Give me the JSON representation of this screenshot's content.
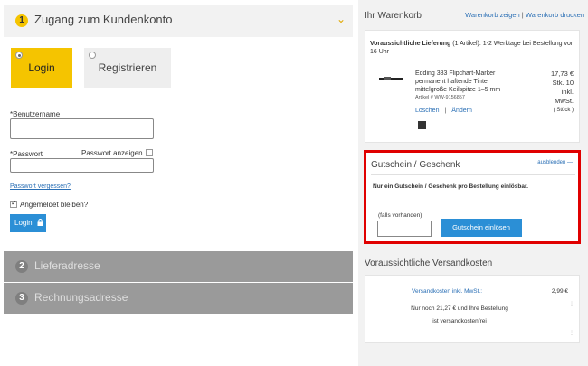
{
  "steps": {
    "step1": {
      "num": "1",
      "title": "Zugang zum Kundenkonto"
    },
    "step2": {
      "num": "2",
      "title": "Lieferadresse"
    },
    "step3": {
      "num": "3",
      "title": "Rechnungsadresse"
    }
  },
  "auth_tabs": {
    "login": "Login",
    "register": "Registrieren"
  },
  "login_form": {
    "username_label": "*Benutzername",
    "password_label": "*Passwort",
    "show_password_label": "Passwort anzeigen",
    "forgot_password": "Passwort vergessen?",
    "remember_label": "Angemeldet bleiben?",
    "login_button": "Login"
  },
  "cart": {
    "title": "Ihr Warenkorb",
    "show_link": "Warenkorb zeigen",
    "print_link": "Warenkorb drucken",
    "links_sep": "|",
    "delivery_bold": "Voraussichtliche Lieferung",
    "delivery_count": "(1 Artikel)",
    "delivery_text": ": 1-2 Werktage bei Bestellung vor 16 Uhr",
    "product": {
      "name_line1": "Edding 383 Flipchart-Marker",
      "name_line2": "permanent haftende Tinte",
      "name_line3": "mittelgroße Keilspitze 1–5 mm",
      "article": "Artikel # WW-9156857",
      "price": "17,73 €",
      "qty": "Stk. 10",
      "vat1": "inkl.",
      "vat2": "MwSt.",
      "unit": "( Stück )",
      "delete": "Löschen",
      "sep": "|",
      "change": "Ändern"
    }
  },
  "voucher": {
    "title": "Gutschein / Geschenk",
    "hide": "ausblenden —",
    "note": "Nur ein Gutschein / Geschenk pro Bestellung einlösbar.",
    "input_label": "(falls vorhanden)",
    "button": "Gutschein einlösen"
  },
  "shipping": {
    "title": "Voraussichtliche Versandkosten",
    "link": "Versandkosten inkl. MwSt.:",
    "price": "2,99 €",
    "note_line1": "Nur noch 21,27 € und Ihre Bestellung",
    "note_line2": "ist versandkostenfrei"
  },
  "colors": {
    "accent": "#f5c400",
    "link": "#2a6fb5",
    "button": "#2b8fd6",
    "highlight_border": "#e00000"
  }
}
